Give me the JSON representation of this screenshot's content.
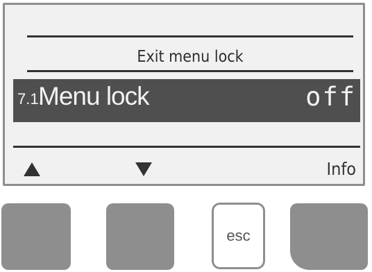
{
  "display": {
    "heading": "Exit menu lock",
    "menu_item": {
      "number": "7.1.",
      "label": "Menu lock",
      "value": "off"
    },
    "softkeys": {
      "key1_icon": "triangle-up-icon",
      "key2_icon": "triangle-down-icon",
      "key4_label": "Info"
    }
  },
  "hardware_buttons": {
    "esc_label": "esc"
  },
  "colors": {
    "lcd_background": "#f1f1f1",
    "selection_background": "#4f4f4f",
    "selection_text": "#f2f2f2",
    "button_gray": "#8e8e8e"
  }
}
